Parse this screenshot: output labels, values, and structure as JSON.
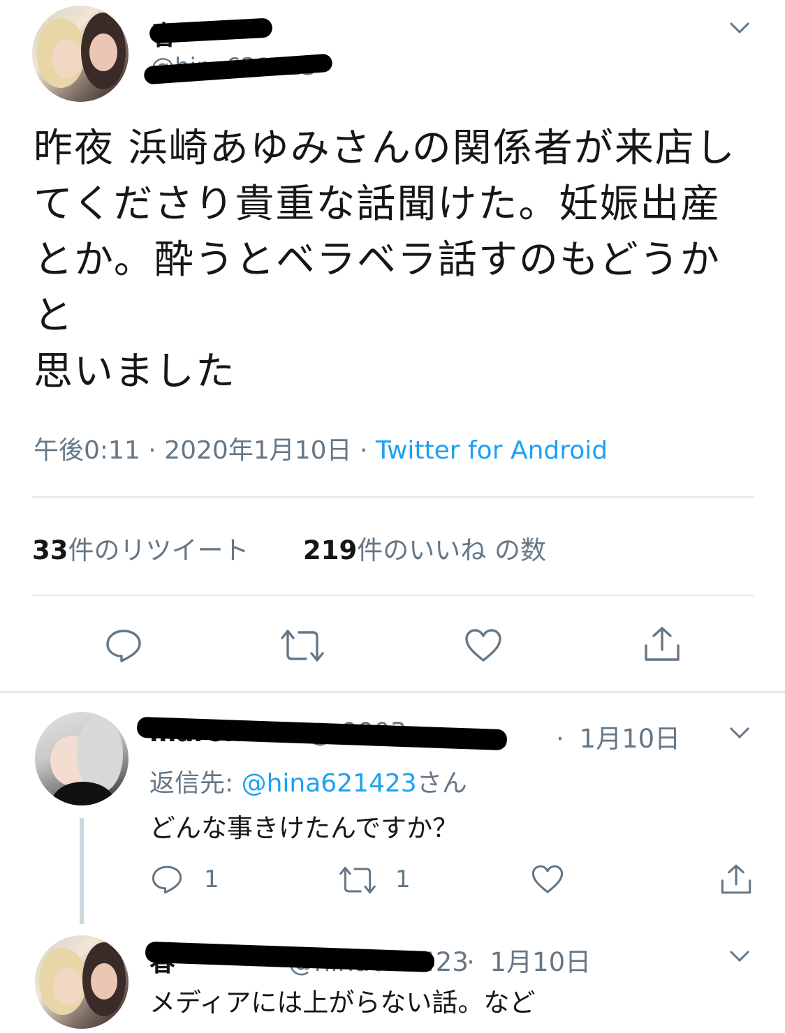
{
  "tweet": {
    "display_name": "春",
    "handle": "@hina621423",
    "text": "昨夜 浜崎あゆみさんの関係者が来店してくださり貴重な話聞けた。妊娠出産とか。酔うとベラベラ話すのもどうかと\n思いました",
    "time": "午後0:11",
    "date": "2020年1月10日",
    "separator": "·",
    "source": "Twitter for Android",
    "retweet_count": "33",
    "retweet_label": "件のリツイート",
    "like_count": "219",
    "like_label": "件のいいね の数"
  },
  "replies": [
    {
      "display_name": "maron",
      "handle_fragment": "@ 0003...",
      "date": "1月10日",
      "reply_to_prefix": "返信先: ",
      "reply_to_handle": "@hina621423",
      "reply_to_suffix": "さん",
      "text": "どんな事きけたんですか？",
      "reply_count": "1",
      "retweet_count": "1"
    },
    {
      "display_name": "春",
      "handle": "@hina621423",
      "date": "1月10日",
      "text": "メディアには上がらない話。など"
    }
  ],
  "icons": [
    "chevron-down-icon",
    "reply-icon",
    "retweet-icon",
    "like-icon",
    "share-icon"
  ],
  "colors": {
    "link": "#1da1f2",
    "secondary": "#657786",
    "divider": "#e1e8ed",
    "text": "#14171a"
  }
}
